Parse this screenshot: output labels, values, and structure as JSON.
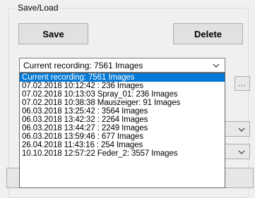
{
  "group": {
    "title": "Save/Load"
  },
  "buttons": {
    "save": "Save",
    "delete": "Delete",
    "ellipsis": "..."
  },
  "combo": {
    "selected": "Current recording: 7561 Images"
  },
  "dropdown": {
    "items": [
      "Current recording: 7561 Images",
      "07.02.2018 10:12:42 : 236 Images",
      "07.02.2018 10:13:03 Spray_01: 236 Images",
      "07.02.2018 10:38:38 Mauszeiger: 91 Images",
      "06.03.2018 13:25:42 : 3564 Images",
      "06.03.2018 13:42:32 : 2264 Images",
      "06.03.2018 13:44:27 : 2249 Images",
      "06.03.2018 13:59:46 : 677 Images",
      "26.04.2018 11:43:16 : 254 Images",
      "10.10.2018 12:57:22 Feder_2: 3557 Images"
    ],
    "selected_index": 0
  },
  "colors": {
    "selection": "#0078d7",
    "background": "#f0f0f0"
  },
  "icons": {
    "combo_arrow": "chevron-down-icon"
  }
}
